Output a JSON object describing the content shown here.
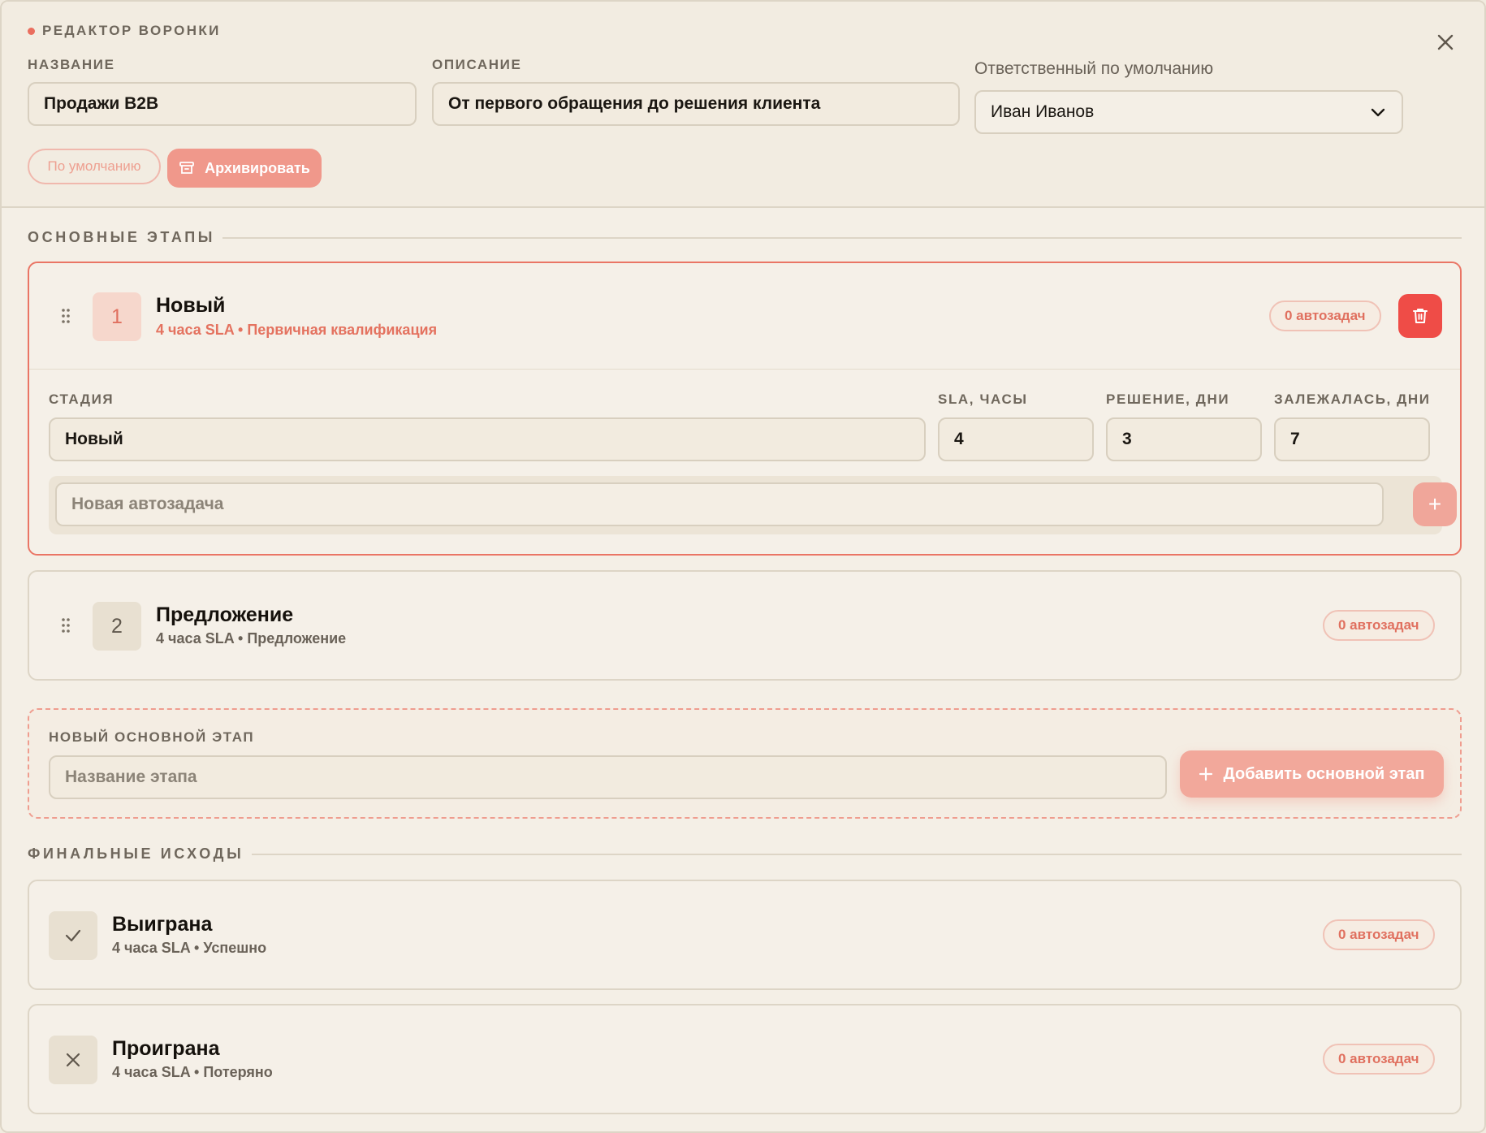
{
  "header": {
    "eyebrow": "РЕДАКТОР ВОРОНКИ",
    "name_label": "НАЗВАНИЕ",
    "name_value": "Продажи B2B",
    "description_label": "ОПИСАНИЕ",
    "description_value": "От первого обращения до решения клиента",
    "owner_label": "Ответственный по умолчанию",
    "owner_value": "Иван Иванов",
    "default_button": "По умолчанию",
    "archive_button": "Архивировать"
  },
  "main_section": {
    "title": "ОСНОВНЫЕ ЭТАПЫ"
  },
  "stages": [
    {
      "number": "1",
      "name": "Новый",
      "meta": "4 часа SLA • Первичная квалификация",
      "autotasks": "0 автозадач",
      "expanded": true,
      "fields": {
        "stage_label": "СТАДИЯ",
        "stage_value": "Новый",
        "sla_label": "SLA, ЧАСЫ",
        "sla_value": "4",
        "decision_label": "РЕШЕНИЕ, ДНИ",
        "decision_value": "3",
        "stale_label": "ЗАЛЕЖАЛАСЬ, ДНИ",
        "stale_value": "7"
      },
      "autotask_placeholder": "Новая автозадача",
      "add_symbol": "+"
    },
    {
      "number": "2",
      "name": "Предложение",
      "meta": "4 часа SLA • Предложение",
      "autotasks": "0 автозадач",
      "expanded": false
    }
  ],
  "new_stage": {
    "label": "НОВЫЙ ОСНОВНОЙ ЭТАП",
    "placeholder": "Название этапа",
    "add_button": "Добавить основной этап"
  },
  "final_section": {
    "title": "ФИНАЛЬНЫЕ ИСХОДЫ"
  },
  "outcomes": [
    {
      "name": "Выиграна",
      "meta": "4 часа SLA • Успешно",
      "autotasks": "0 автозадач",
      "icon": "check-icon"
    },
    {
      "name": "Проиграна",
      "meta": "4 часа SLA • Потеряно",
      "autotasks": "0 автозадач",
      "icon": "x-icon"
    }
  ],
  "colors": {
    "accent": "#ea6e5e",
    "danger": "#ef4c47",
    "background": "#f4efe6",
    "border": "#ddd5c6"
  }
}
